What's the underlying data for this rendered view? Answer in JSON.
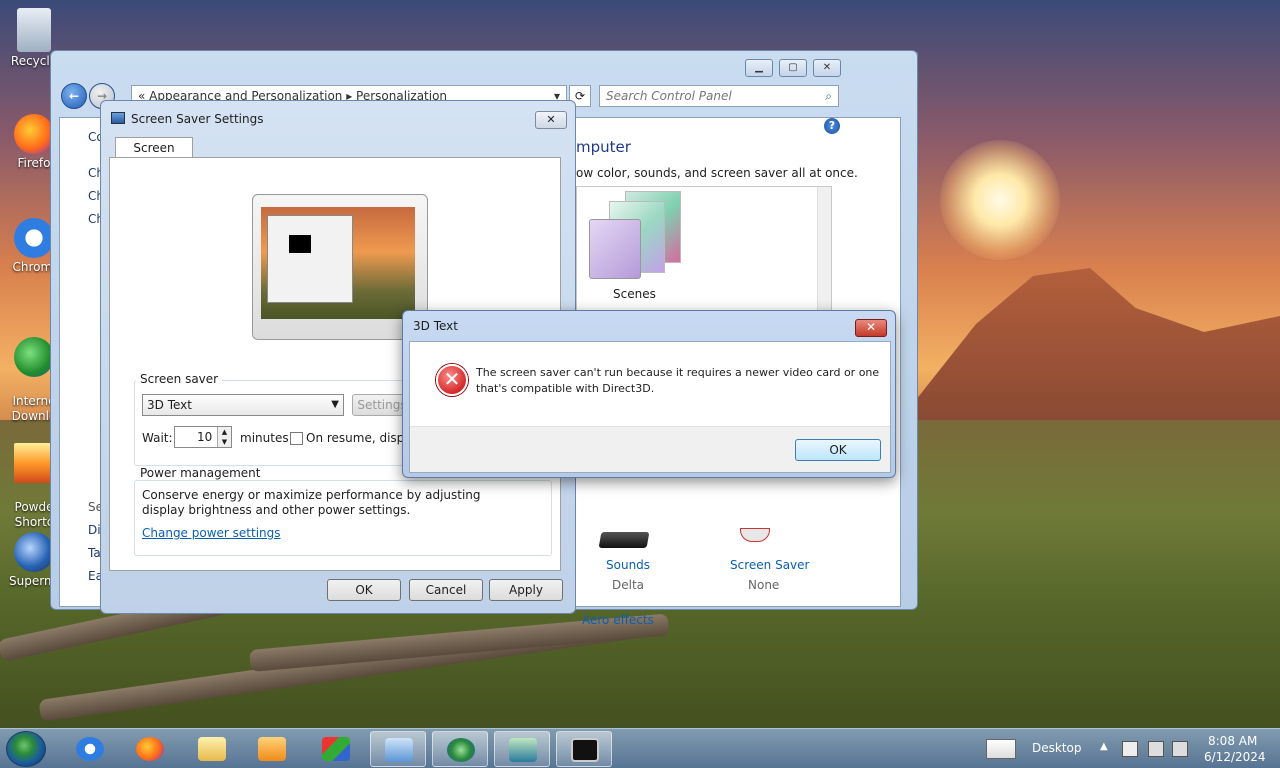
{
  "desktop": {
    "icons": [
      {
        "label": "Recycle"
      },
      {
        "label": "Firefo"
      },
      {
        "label": "Chromi"
      },
      {
        "label": "Interne\nDownlo"
      },
      {
        "label": "Powde\nShortc"
      },
      {
        "label": "Supermi"
      }
    ]
  },
  "explorer": {
    "address": "«  Appearance and Personalization  ▸  Personalization",
    "search_placeholder": "Search Control Panel",
    "left_items": [
      "Co",
      "Ch",
      "Ch",
      "Ch"
    ],
    "left_bottom": [
      "Se",
      "Di",
      "Ta",
      "Ea"
    ],
    "heading": "mputer",
    "subtitle": "ow color, sounds, and screen saver all at once.",
    "theme_label": "Scenes",
    "sounds_label": "Sounds",
    "sounds_value": "Delta",
    "screensaver_label": "Screen Saver",
    "screensaver_value": "None",
    "aero_link": "Aero effects"
  },
  "screen_saver_dialog": {
    "title": "Screen Saver Settings",
    "tab": "Screen Saver",
    "group_label": "Screen saver",
    "selected_saver": "3D Text",
    "settings_button": "Settings",
    "wait_label": "Wait:",
    "wait_value": "10",
    "minutes_label": "minutes",
    "resume_label": "On resume, display",
    "power_group": "Power management",
    "power_text": "Conserve energy or maximize performance by adjusting display brightness and other power settings.",
    "power_link": "Change power settings",
    "ok": "OK",
    "cancel": "Cancel",
    "apply": "Apply"
  },
  "error_dialog": {
    "title": "3D Text",
    "message_line1": "The screen saver can't run because it requires a newer video card or one",
    "message_line2": "that's compatible with Direct3D.",
    "ok": "OK",
    "close": "✕"
  },
  "taskbar": {
    "desktop_label": "Desktop",
    "time": "8:08 AM",
    "date": "6/12/2024"
  },
  "colors": {
    "accent": "#0b5fb3",
    "error": "#c00000"
  }
}
